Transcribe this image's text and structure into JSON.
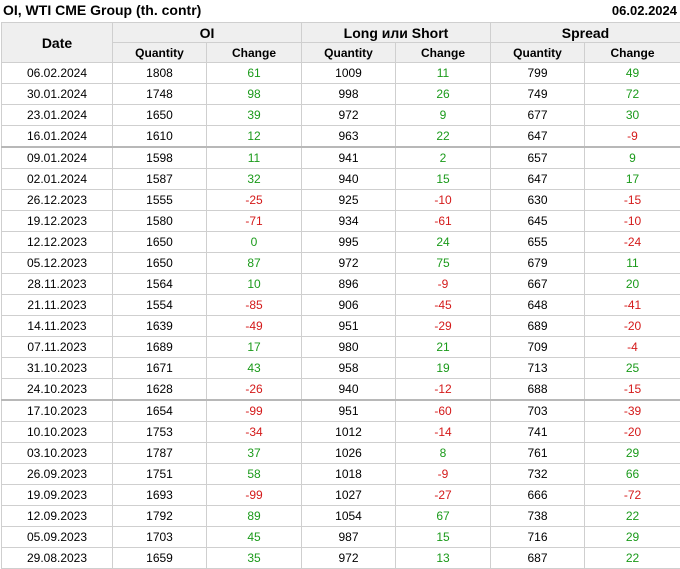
{
  "header": {
    "title": "OI, WTI CME Group (th. contr)",
    "date": "06.02.2024"
  },
  "columns": {
    "date": "Date",
    "group_oi": "OI",
    "group_ls": "Long или Short",
    "group_spread": "Spread",
    "quantity": "Quantity",
    "change": "Change"
  },
  "colors": {
    "positive": "#1a9a1a",
    "negative": "#d41a1a",
    "header_bg": "#efefef"
  },
  "separators_before_rows": [
    4,
    16
  ],
  "rows": [
    {
      "date": "06.02.2024",
      "oi_q": "1808",
      "oi_c": "61",
      "ls_q": "1009",
      "ls_c": "11",
      "sp_q": "799",
      "sp_c": "49"
    },
    {
      "date": "30.01.2024",
      "oi_q": "1748",
      "oi_c": "98",
      "ls_q": "998",
      "ls_c": "26",
      "sp_q": "749",
      "sp_c": "72"
    },
    {
      "date": "23.01.2024",
      "oi_q": "1650",
      "oi_c": "39",
      "ls_q": "972",
      "ls_c": "9",
      "sp_q": "677",
      "sp_c": "30"
    },
    {
      "date": "16.01.2024",
      "oi_q": "1610",
      "oi_c": "12",
      "ls_q": "963",
      "ls_c": "22",
      "sp_q": "647",
      "sp_c": "-9"
    },
    {
      "date": "09.01.2024",
      "oi_q": "1598",
      "oi_c": "11",
      "ls_q": "941",
      "ls_c": "2",
      "sp_q": "657",
      "sp_c": "9"
    },
    {
      "date": "02.01.2024",
      "oi_q": "1587",
      "oi_c": "32",
      "ls_q": "940",
      "ls_c": "15",
      "sp_q": "647",
      "sp_c": "17"
    },
    {
      "date": "26.12.2023",
      "oi_q": "1555",
      "oi_c": "-25",
      "ls_q": "925",
      "ls_c": "-10",
      "sp_q": "630",
      "sp_c": "-15"
    },
    {
      "date": "19.12.2023",
      "oi_q": "1580",
      "oi_c": "-71",
      "ls_q": "934",
      "ls_c": "-61",
      "sp_q": "645",
      "sp_c": "-10"
    },
    {
      "date": "12.12.2023",
      "oi_q": "1650",
      "oi_c": "0",
      "ls_q": "995",
      "ls_c": "24",
      "sp_q": "655",
      "sp_c": "-24"
    },
    {
      "date": "05.12.2023",
      "oi_q": "1650",
      "oi_c": "87",
      "ls_q": "972",
      "ls_c": "75",
      "sp_q": "679",
      "sp_c": "11"
    },
    {
      "date": "28.11.2023",
      "oi_q": "1564",
      "oi_c": "10",
      "ls_q": "896",
      "ls_c": "-9",
      "sp_q": "667",
      "sp_c": "20"
    },
    {
      "date": "21.11.2023",
      "oi_q": "1554",
      "oi_c": "-85",
      "ls_q": "906",
      "ls_c": "-45",
      "sp_q": "648",
      "sp_c": "-41"
    },
    {
      "date": "14.11.2023",
      "oi_q": "1639",
      "oi_c": "-49",
      "ls_q": "951",
      "ls_c": "-29",
      "sp_q": "689",
      "sp_c": "-20"
    },
    {
      "date": "07.11.2023",
      "oi_q": "1689",
      "oi_c": "17",
      "ls_q": "980",
      "ls_c": "21",
      "sp_q": "709",
      "sp_c": "-4"
    },
    {
      "date": "31.10.2023",
      "oi_q": "1671",
      "oi_c": "43",
      "ls_q": "958",
      "ls_c": "19",
      "sp_q": "713",
      "sp_c": "25"
    },
    {
      "date": "24.10.2023",
      "oi_q": "1628",
      "oi_c": "-26",
      "ls_q": "940",
      "ls_c": "-12",
      "sp_q": "688",
      "sp_c": "-15"
    },
    {
      "date": "17.10.2023",
      "oi_q": "1654",
      "oi_c": "-99",
      "ls_q": "951",
      "ls_c": "-60",
      "sp_q": "703",
      "sp_c": "-39"
    },
    {
      "date": "10.10.2023",
      "oi_q": "1753",
      "oi_c": "-34",
      "ls_q": "1012",
      "ls_c": "-14",
      "sp_q": "741",
      "sp_c": "-20"
    },
    {
      "date": "03.10.2023",
      "oi_q": "1787",
      "oi_c": "37",
      "ls_q": "1026",
      "ls_c": "8",
      "sp_q": "761",
      "sp_c": "29"
    },
    {
      "date": "26.09.2023",
      "oi_q": "1751",
      "oi_c": "58",
      "ls_q": "1018",
      "ls_c": "-9",
      "sp_q": "732",
      "sp_c": "66"
    },
    {
      "date": "19.09.2023",
      "oi_q": "1693",
      "oi_c": "-99",
      "ls_q": "1027",
      "ls_c": "-27",
      "sp_q": "666",
      "sp_c": "-72"
    },
    {
      "date": "12.09.2023",
      "oi_q": "1792",
      "oi_c": "89",
      "ls_q": "1054",
      "ls_c": "67",
      "sp_q": "738",
      "sp_c": "22"
    },
    {
      "date": "05.09.2023",
      "oi_q": "1703",
      "oi_c": "45",
      "ls_q": "987",
      "ls_c": "15",
      "sp_q": "716",
      "sp_c": "29"
    },
    {
      "date": "29.08.2023",
      "oi_q": "1659",
      "oi_c": "35",
      "ls_q": "972",
      "ls_c": "13",
      "sp_q": "687",
      "sp_c": "22"
    }
  ]
}
